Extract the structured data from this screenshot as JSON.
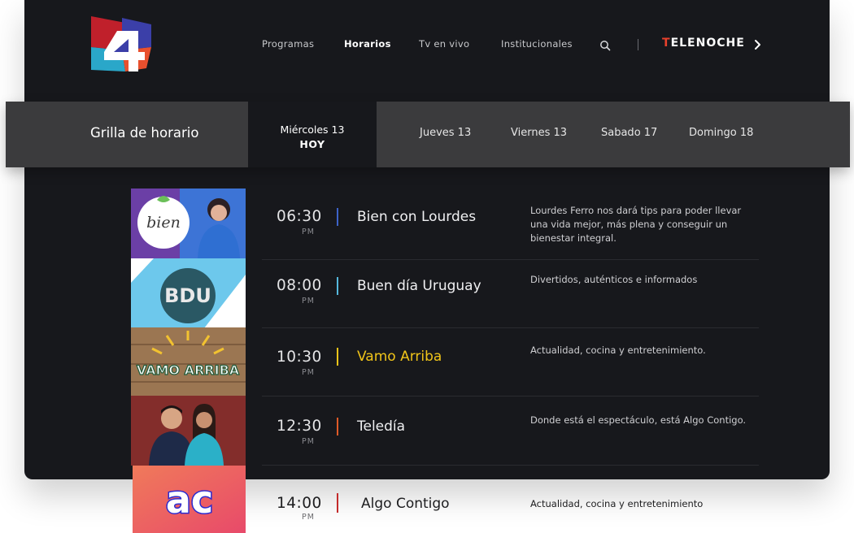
{
  "brand": {
    "logo_icon": "channel-4-logo",
    "accent": "#e8412c"
  },
  "nav": {
    "items": [
      {
        "label": "Programas",
        "active": false
      },
      {
        "label": "Horarios",
        "active": true
      },
      {
        "label": "Tv en vivo",
        "active": false
      },
      {
        "label": "Institucionales",
        "active": false
      }
    ],
    "search_icon": "search-icon",
    "telenoche": {
      "first": "T",
      "rest": "ELENOCHE"
    }
  },
  "days": {
    "title": "Grilla de horario",
    "active": {
      "name": "Miércoles 13",
      "today": "HOY"
    },
    "tabs": [
      "Jueves 13",
      "Viernes 13",
      "Sabado 17",
      "Domingo 18"
    ]
  },
  "schedule": [
    {
      "time": "06:30",
      "ampm": "PM",
      "title": "Bien con Lourdes",
      "accent": "#3d63c9",
      "description": "Lourdes Ferro nos dará tips para poder llevar una vida mejor, más plena y conseguir un bienestar integral.",
      "thumb_text": "bien"
    },
    {
      "time": "08:00",
      "ampm": "PM",
      "title": "Buen día Uruguay",
      "accent": "#55b9dd",
      "description": "Divertidos, auténticos e informados",
      "thumb_text": "BDU"
    },
    {
      "time": "10:30",
      "ampm": "PM",
      "title": "Vamo Arriba",
      "accent": "#f0c419",
      "description": "Actualidad, cocina y entretenimiento.",
      "thumb_text": "VAMO ARRIBA"
    },
    {
      "time": "12:30",
      "ampm": "PM",
      "title": "Teledía",
      "accent": "#e05a28",
      "description": "Donde está el espectáculo, está Algo Contigo.",
      "thumb_text": ""
    },
    {
      "time": "14:00",
      "ampm": "PM",
      "title": "Algo Contigo",
      "accent": "#c32a2a",
      "description": "Actualidad, cocina y entretenimiento",
      "thumb_text": "ac"
    }
  ]
}
